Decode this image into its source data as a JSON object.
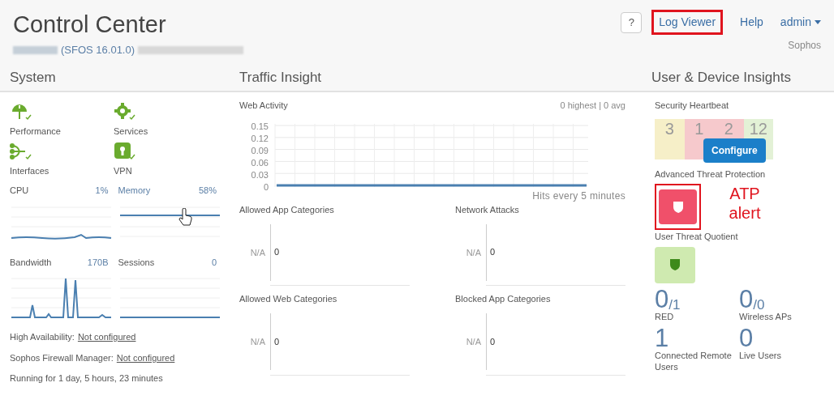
{
  "header": {
    "title": "Control Center",
    "version": "(SFOS 16.01.0)",
    "help_button": "?",
    "links": [
      {
        "label": "Log Viewer",
        "highlighted": true
      },
      {
        "label": "Help",
        "highlighted": false
      }
    ],
    "user_menu": "admin",
    "company": "Sophos"
  },
  "system": {
    "title": "System",
    "status": [
      {
        "label": "Performance",
        "kind": "gauge",
        "healthy": true
      },
      {
        "label": "Services",
        "kind": "gear",
        "healthy": true
      },
      {
        "label": "Interfaces",
        "kind": "fork",
        "healthy": true
      },
      {
        "label": "VPN",
        "kind": "lock",
        "healthy": true
      }
    ],
    "metrics": [
      {
        "label": "CPU",
        "value": "1%",
        "kind": "wave"
      },
      {
        "label": "Memory",
        "value": "58%",
        "kind": "high"
      },
      {
        "label": "Bandwidth",
        "value": "170B",
        "kind": "spikes"
      },
      {
        "label": "Sessions",
        "value": "0",
        "kind": "flat"
      }
    ],
    "info": [
      {
        "label": "High Availability:",
        "link": "Not configured"
      },
      {
        "label": "Sophos Firewall Manager:",
        "link": "Not configured"
      },
      {
        "label": "Running for 1 day, 5 hours, 23 minutes"
      }
    ]
  },
  "traffic": {
    "title": "Traffic Insight",
    "web_activity": {
      "title": "Web Activity",
      "summary": "0 highest | 0 avg",
      "footnote": "Hits every 5 minutes",
      "chart_data": {
        "type": "line",
        "grid": true,
        "ylim": [
          0,
          0.15
        ],
        "yticks": [
          {
            "value": 0,
            "label": "0"
          },
          {
            "value": 0.03,
            "label": "0.03"
          },
          {
            "value": 0.06,
            "label": "0.06"
          },
          {
            "value": 0.09,
            "label": "0.09"
          },
          {
            "value": 0.12,
            "label": "0.12"
          },
          {
            "value": 0.15,
            "label": "0.15"
          }
        ],
        "series": [
          {
            "color": "#4a7fb0",
            "values": [
              0,
              0,
              0,
              0,
              0,
              0,
              0,
              0,
              0,
              0,
              0,
              0,
              0,
              0,
              0,
              0
            ]
          }
        ]
      }
    },
    "panels": [
      {
        "title": "Allowed App Categories",
        "category": "N/A",
        "value": "0"
      },
      {
        "title": "Network Attacks",
        "category": "N/A",
        "value": "0"
      },
      {
        "title": "Allowed Web Categories",
        "category": "N/A",
        "value": "0"
      },
      {
        "title": "Blocked App Categories",
        "category": "N/A",
        "value": "0"
      }
    ]
  },
  "insights": {
    "title": "User & Device Insights",
    "heartbeat": {
      "title": "Security Heartbeat",
      "tiles": [
        {
          "value": "3",
          "color": "#f6efc8"
        },
        {
          "value": "1",
          "color": "#f6c9cc"
        },
        {
          "value": "2",
          "color": "#f6c9cc"
        },
        {
          "value": "12",
          "color": "#e3f1d6"
        }
      ],
      "button": "Configure"
    },
    "atp": {
      "title": "Advanced Threat Protection",
      "alert": true,
      "annotation": "ATP alert"
    },
    "utq": {
      "title": "User Threat Quotient",
      "alert": false
    },
    "counters": [
      {
        "value": "0",
        "total": "/1",
        "label": "RED"
      },
      {
        "value": "0",
        "total": "/0",
        "label": "Wireless APs"
      },
      {
        "value": "1",
        "label": "Connected Remote Users"
      },
      {
        "value": "0",
        "label": "Live Users"
      }
    ]
  }
}
